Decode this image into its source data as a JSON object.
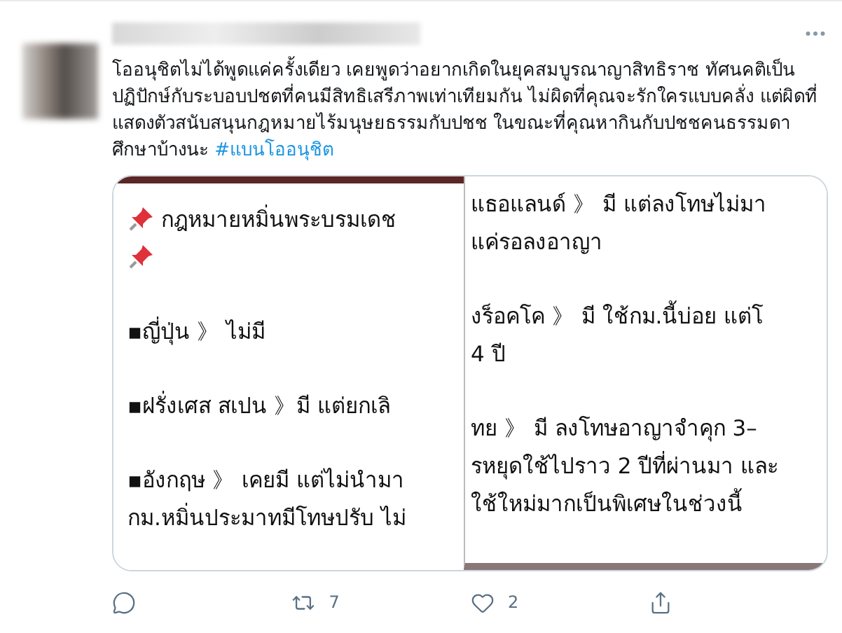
{
  "tweet": {
    "text": "โออนุชิตไม่ได้พูดแค่ครั้งเดียว เคยพูดว่าอยากเกิดในยุคสมบูรณาญาสิทธิราช ทัศนคติเป็นปฏิปักษ์กับระบอบปชตที่คนมีสิทธิเสรีภาพเท่าเทียมกัน ไม่ผิดที่คุณจะรักใครแบบคลั่ง แต่ผิดที่แสดงตัวสนับสนุนกฎหมายไร้มนุษยธรรมกับปชช ในขณะที่คุณหากินกับปชชคนธรรมดา ศึกษาบ้างนะ",
    "hashtag": "#แบนโออนุชิต"
  },
  "media": {
    "left": [
      {
        "kind": "pin",
        "text": "กฎหมายหมิ่นพระบรมเดช"
      },
      {
        "kind": "pin"
      },
      {
        "kind": "gap"
      },
      {
        "kind": "line",
        "text": "▪ญี่ปุ่น 》 ไม่มี"
      },
      {
        "kind": "gap"
      },
      {
        "kind": "line",
        "text": "▪ฝรั่งเศส สเปน 》มี แต่ยกเลิ"
      },
      {
        "kind": "gap"
      },
      {
        "kind": "line",
        "text": "▪อังกฤษ 》 เคยมี แต่ไม่นำมา"
      },
      {
        "kind": "line",
        "text": "กม.หมิ่นประมาทมีโทษปรับ ไม่"
      }
    ],
    "right": [
      {
        "kind": "line",
        "text": "แธอแลนด์ 》 มี แต่ลงโทษไม่มา"
      },
      {
        "kind": "line",
        "text": "แค่รอลงอาญา"
      },
      {
        "kind": "gap"
      },
      {
        "kind": "line",
        "text": "งร็อคโค 》 มี ใช้กม.นี้บ่อย แต่โ"
      },
      {
        "kind": "line",
        "text": "4 ปี"
      },
      {
        "kind": "gap"
      },
      {
        "kind": "line",
        "text": "ทย 》 มี ลงโทษอาญาจำคุก 3–"
      },
      {
        "kind": "line",
        "text": "รหยุดใช้ไปราว 2 ปีที่ผ่านมา และ"
      },
      {
        "kind": "line",
        "text": "ใช้ใหม่มากเป็นพิเศษในช่วงนี้"
      }
    ]
  },
  "actions": [
    {
      "kind": "reply"
    },
    {
      "kind": "retweet",
      "count": "7"
    },
    {
      "kind": "like",
      "count": "2"
    },
    {
      "kind": "share"
    }
  ]
}
